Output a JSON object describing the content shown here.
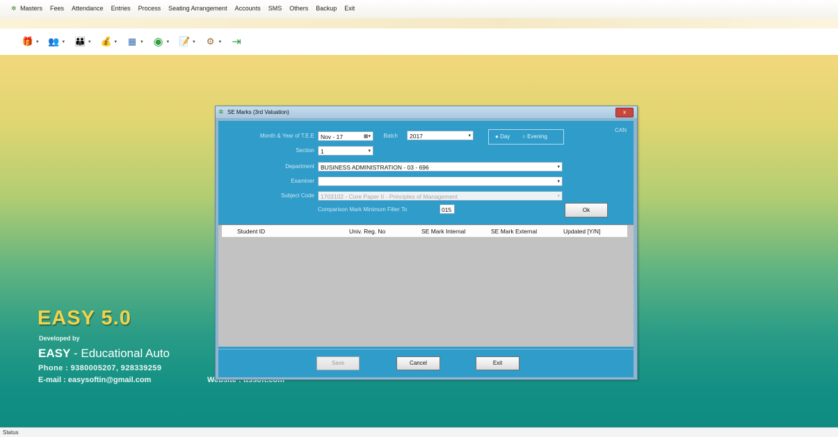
{
  "menu": {
    "items": [
      "Masters",
      "Fees",
      "Attendance",
      "Entries",
      "Process",
      "Seating Arrangement",
      "Accounts",
      "SMS",
      "Others",
      "Backup",
      "Exit"
    ]
  },
  "toolbar": {
    "icons": [
      "gift-icon",
      "users-icon",
      "group-icon",
      "money-icon",
      "calendar-icon",
      "refresh-icon",
      "notepad-icon",
      "settings-icon",
      "exit-door-icon"
    ]
  },
  "status": {
    "text": "Status"
  },
  "brand": {
    "title": "EASY 5.0",
    "developed_by": "Developed by",
    "company_bold": "EASY",
    "company_rest": " - Educational Auto",
    "phone": "Phone : 9380005207, 928339259",
    "email": "E-mail : easysoftin@gmail.com",
    "website": "Website : ttssoft.com"
  },
  "dialog": {
    "title": "SE Marks (3rd Valuation)",
    "close": "x",
    "corner": "CAN",
    "labels": {
      "month_year": "Month & Year of T.E.E",
      "batch": "Batch",
      "section": "Section",
      "department": "Department",
      "examiner": "Examiner",
      "subject_code": "Subject Code",
      "comparison": "Comparison Mark Minimum Filter To"
    },
    "values": {
      "month_year": "Nov - 17",
      "batch": "2017",
      "section": "1",
      "department": "BUSINESS ADMINISTRATION - 03 - 696",
      "examiner": "",
      "subject_code": "1703102    - Core Paper II - Principles of Management",
      "comparison": "015"
    },
    "radio": {
      "day": "Day",
      "evening": "Evening",
      "selected": "day"
    },
    "ok_button": "Ok",
    "columns": [
      "Student ID",
      "Univ. Reg. No",
      "SE Mark Internal",
      "SE Mark External",
      "Updated [Y/N]"
    ],
    "buttons": {
      "save": "Save",
      "cancel": "Cancel",
      "exit": "Exit"
    }
  }
}
